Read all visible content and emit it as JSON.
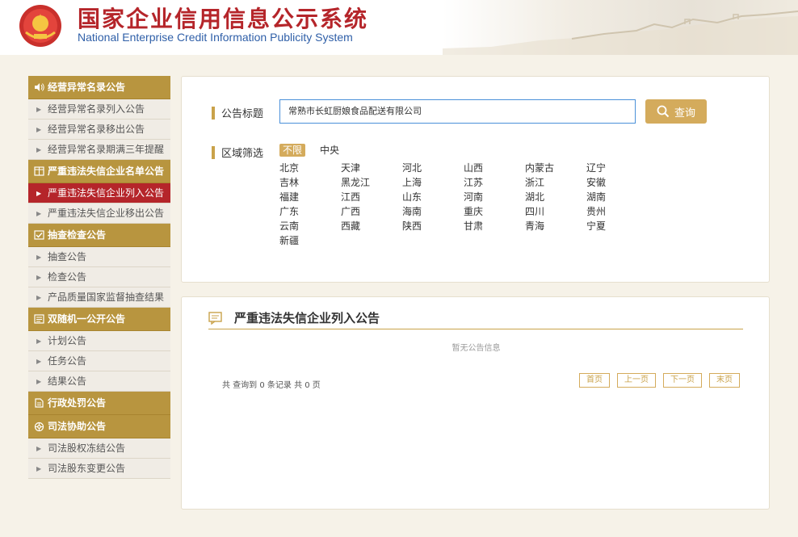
{
  "header": {
    "title_cn": "国家企业信用信息公示系统",
    "title_en": "National Enterprise Credit Information Publicity System"
  },
  "sidebar": {
    "groups": [
      {
        "label": "经营异常名录公告",
        "icon": "speaker-icon",
        "items": [
          "经营异常名录列入公告",
          "经营异常名录移出公告",
          "经营异常名录期满三年提醒"
        ]
      },
      {
        "label": "严重违法失信企业名单公告",
        "icon": "book-icon",
        "items": [
          "严重违法失信企业列入公告",
          "严重违法失信企业移出公告"
        ]
      },
      {
        "label": "抽查检查公告",
        "icon": "checkbox-icon",
        "items": [
          "抽查公告",
          "检查公告",
          "产品质量国家监督抽查结果"
        ]
      },
      {
        "label": "双随机一公开公告",
        "icon": "board-icon",
        "items": [
          "计划公告",
          "任务公告",
          "结果公告"
        ]
      },
      {
        "label": "行政处罚公告",
        "icon": "document-icon",
        "items": []
      },
      {
        "label": "司法协助公告",
        "icon": "gear-icon",
        "items": [
          "司法股权冻结公告",
          "司法股东变更公告"
        ]
      }
    ],
    "active_item": "严重违法失信企业列入公告"
  },
  "search": {
    "title_label": "公告标题",
    "title_value": "常熟市长虹厨娘食品配送有限公司",
    "search_button": "查询",
    "region_label": "区域筛选",
    "region_unlimited": "不限",
    "region_central": "中央",
    "regions": [
      [
        "北京",
        "天津",
        "河北",
        "山西",
        "内蒙古",
        "辽宁"
      ],
      [
        "吉林",
        "黑龙江",
        "上海",
        "江苏",
        "浙江",
        "安徽"
      ],
      [
        "福建",
        "江西",
        "山东",
        "河南",
        "湖北",
        "湖南"
      ],
      [
        "广东",
        "广西",
        "海南",
        "重庆",
        "四川",
        "贵州"
      ],
      [
        "云南",
        "西藏",
        "陕西",
        "甘肃",
        "青海",
        "宁夏"
      ],
      [
        "新疆"
      ]
    ]
  },
  "results": {
    "title": "严重违法失信企业列入公告",
    "empty_message": "暂无公告信息",
    "count_text": "共 查询到 0 条记录 共 0 页",
    "pager": {
      "first": "首页",
      "prev": "上一页",
      "next": "下一页",
      "last": "末页"
    }
  },
  "colors": {
    "gold": "#b8953f",
    "red": "#b5252a",
    "accent_button": "#d4ab5c",
    "input_border": "#4a90d9"
  }
}
